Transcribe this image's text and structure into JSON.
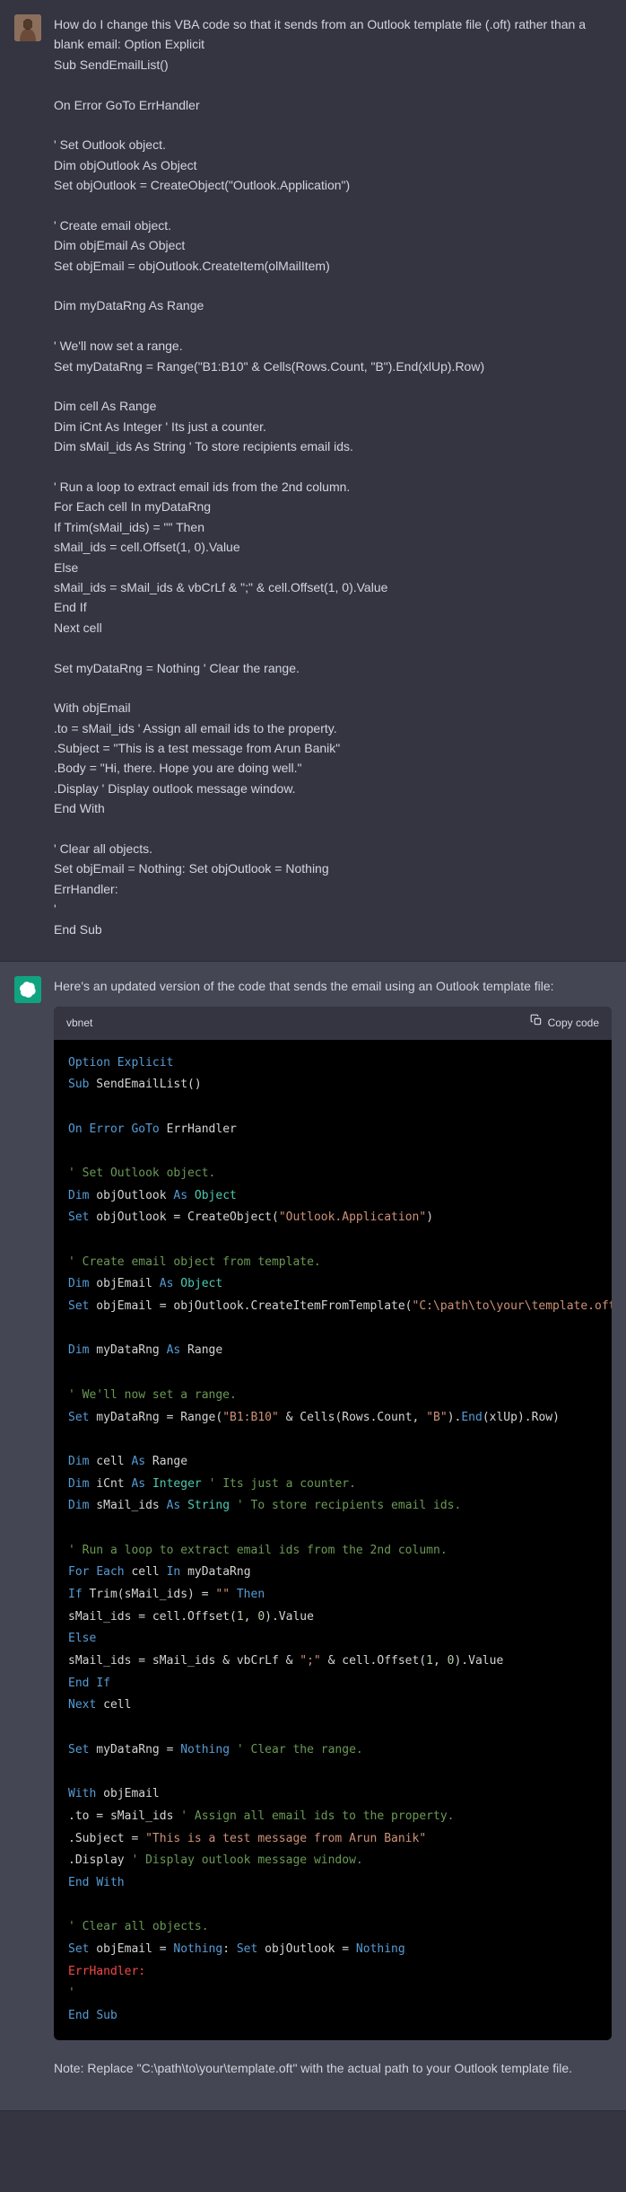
{
  "user": {
    "prompt_intro": "How do I change this VBA code so that it sends from an Outlook template file (.oft) rather than a blank email: Option Explicit",
    "lines": [
      "Sub SendEmailList()",
      "",
      "On Error GoTo ErrHandler",
      "",
      "' Set Outlook object.",
      "Dim objOutlook As Object",
      "Set objOutlook = CreateObject(\"Outlook.Application\")",
      "",
      "' Create email object.",
      "Dim objEmail As Object",
      "Set objEmail = objOutlook.CreateItem(olMailItem)",
      "",
      "Dim myDataRng As Range",
      "",
      "' We'll now set a range.",
      "Set myDataRng = Range(\"B1:B10\" & Cells(Rows.Count, \"B\").End(xlUp).Row)",
      "",
      "Dim cell As Range",
      "Dim iCnt As Integer ' Its just a counter.",
      "Dim sMail_ids As String ' To store recipients email ids.",
      "",
      "' Run a loop to extract email ids from the 2nd column.",
      "For Each cell In myDataRng",
      "If Trim(sMail_ids) = \"\" Then",
      "sMail_ids = cell.Offset(1, 0).Value",
      "Else",
      "sMail_ids = sMail_ids & vbCrLf & \";\" & cell.Offset(1, 0).Value",
      "End If",
      "Next cell",
      "",
      "Set myDataRng = Nothing ' Clear the range.",
      "",
      "With objEmail",
      ".to = sMail_ids ' Assign all email ids to the property.",
      ".Subject = \"This is a test message from Arun Banik\"",
      ".Body = \"Hi, there. Hope you are doing well.\"",
      ".Display ' Display outlook message window.",
      "End With",
      "",
      "' Clear all objects.",
      "Set objEmail = Nothing: Set objOutlook = Nothing",
      "ErrHandler:",
      "'",
      "End Sub"
    ]
  },
  "assistant": {
    "intro": "Here's an updated version of the code that sends the email using an Outlook template file:",
    "note": "Note: Replace \"C:\\path\\to\\your\\template.oft\" with the actual path to your Outlook template file.",
    "code_lang": "vbnet",
    "copy_label": "Copy code",
    "code_lines": [
      [
        [
          "key",
          "Option"
        ],
        [
          "sym",
          " "
        ],
        [
          "key",
          "Explicit"
        ]
      ],
      [
        [
          "key",
          "Sub"
        ],
        [
          "sym",
          " SendEmailList()"
        ]
      ],
      [],
      [
        [
          "key",
          "On"
        ],
        [
          "sym",
          " "
        ],
        [
          "key",
          "Error"
        ],
        [
          "sym",
          " "
        ],
        [
          "key",
          "GoTo"
        ],
        [
          "sym",
          " ErrHandler"
        ]
      ],
      [],
      [
        [
          "com",
          "' Set Outlook object."
        ]
      ],
      [
        [
          "key",
          "Dim"
        ],
        [
          "sym",
          " objOutlook "
        ],
        [
          "key",
          "As"
        ],
        [
          "sym",
          " "
        ],
        [
          "type",
          "Object"
        ]
      ],
      [
        [
          "key",
          "Set"
        ],
        [
          "sym",
          " objOutlook = CreateObject("
        ],
        [
          "str",
          "\"Outlook.Application\""
        ],
        [
          "sym",
          ")"
        ]
      ],
      [],
      [
        [
          "com",
          "' Create email object from template."
        ]
      ],
      [
        [
          "key",
          "Dim"
        ],
        [
          "sym",
          " objEmail "
        ],
        [
          "key",
          "As"
        ],
        [
          "sym",
          " "
        ],
        [
          "type",
          "Object"
        ]
      ],
      [
        [
          "key",
          "Set"
        ],
        [
          "sym",
          " objEmail = objOutlook.CreateItemFromTemplate("
        ],
        [
          "str",
          "\"C:\\path\\to\\your\\template.oft\""
        ],
        [
          "sym",
          ")"
        ]
      ],
      [],
      [
        [
          "key",
          "Dim"
        ],
        [
          "sym",
          " myDataRng "
        ],
        [
          "key",
          "As"
        ],
        [
          "sym",
          " Range"
        ]
      ],
      [],
      [
        [
          "com",
          "' We'll now set a range."
        ]
      ],
      [
        [
          "key",
          "Set"
        ],
        [
          "sym",
          " myDataRng = Range("
        ],
        [
          "str",
          "\"B1:B10\""
        ],
        [
          "sym",
          " & Cells(Rows.Count, "
        ],
        [
          "str",
          "\"B\""
        ],
        [
          "sym",
          ")."
        ],
        [
          "key",
          "End"
        ],
        [
          "sym",
          "(xlUp).Row)"
        ]
      ],
      [],
      [
        [
          "key",
          "Dim"
        ],
        [
          "sym",
          " cell "
        ],
        [
          "key",
          "As"
        ],
        [
          "sym",
          " Range"
        ]
      ],
      [
        [
          "key",
          "Dim"
        ],
        [
          "sym",
          " iCnt "
        ],
        [
          "key",
          "As"
        ],
        [
          "sym",
          " "
        ],
        [
          "type",
          "Integer"
        ],
        [
          "sym",
          " "
        ],
        [
          "com",
          "' Its just a counter."
        ]
      ],
      [
        [
          "key",
          "Dim"
        ],
        [
          "sym",
          " sMail_ids "
        ],
        [
          "key",
          "As"
        ],
        [
          "sym",
          " "
        ],
        [
          "type",
          "String"
        ],
        [
          "sym",
          " "
        ],
        [
          "com",
          "' To store recipients email ids."
        ]
      ],
      [],
      [
        [
          "com",
          "' Run a loop to extract email ids from the 2nd column."
        ]
      ],
      [
        [
          "key",
          "For"
        ],
        [
          "sym",
          " "
        ],
        [
          "key",
          "Each"
        ],
        [
          "sym",
          " cell "
        ],
        [
          "key",
          "In"
        ],
        [
          "sym",
          " myDataRng"
        ]
      ],
      [
        [
          "key",
          "If"
        ],
        [
          "sym",
          " Trim(sMail_ids) = "
        ],
        [
          "str",
          "\"\""
        ],
        [
          "sym",
          " "
        ],
        [
          "key",
          "Then"
        ]
      ],
      [
        [
          "sym",
          "sMail_ids = cell.Offset("
        ],
        [
          "num",
          "1"
        ],
        [
          "sym",
          ", "
        ],
        [
          "num",
          "0"
        ],
        [
          "sym",
          ").Value"
        ]
      ],
      [
        [
          "key",
          "Else"
        ]
      ],
      [
        [
          "sym",
          "sMail_ids = sMail_ids & vbCrLf & "
        ],
        [
          "str",
          "\";\""
        ],
        [
          "sym",
          " & cell.Offset("
        ],
        [
          "num",
          "1"
        ],
        [
          "sym",
          ", "
        ],
        [
          "num",
          "0"
        ],
        [
          "sym",
          ").Value"
        ]
      ],
      [
        [
          "key",
          "End"
        ],
        [
          "sym",
          " "
        ],
        [
          "key",
          "If"
        ]
      ],
      [
        [
          "key",
          "Next"
        ],
        [
          "sym",
          " cell"
        ]
      ],
      [],
      [
        [
          "key",
          "Set"
        ],
        [
          "sym",
          " myDataRng = "
        ],
        [
          "key",
          "Nothing"
        ],
        [
          "sym",
          " "
        ],
        [
          "com",
          "' Clear the range."
        ]
      ],
      [],
      [
        [
          "key",
          "With"
        ],
        [
          "sym",
          " objEmail"
        ]
      ],
      [
        [
          "sym",
          ".to = sMail_ids "
        ],
        [
          "com",
          "' Assign all email ids to the property."
        ]
      ],
      [
        [
          "sym",
          ".Subject = "
        ],
        [
          "str",
          "\"This is a test message from Arun Banik\""
        ]
      ],
      [
        [
          "sym",
          ".Display "
        ],
        [
          "com",
          "' Display outlook message window."
        ]
      ],
      [
        [
          "key",
          "End"
        ],
        [
          "sym",
          " "
        ],
        [
          "key",
          "With"
        ]
      ],
      [],
      [
        [
          "com",
          "' Clear all objects."
        ]
      ],
      [
        [
          "key",
          "Set"
        ],
        [
          "sym",
          " objEmail = "
        ],
        [
          "key",
          "Nothing"
        ],
        [
          "sym",
          ": "
        ],
        [
          "key",
          "Set"
        ],
        [
          "sym",
          " objOutlook = "
        ],
        [
          "key",
          "Nothing"
        ]
      ],
      [
        [
          "err",
          "ErrHandler:"
        ]
      ],
      [
        [
          "com",
          "'"
        ]
      ],
      [
        [
          "key",
          "End"
        ],
        [
          "sym",
          " "
        ],
        [
          "key",
          "Sub"
        ]
      ]
    ]
  }
}
